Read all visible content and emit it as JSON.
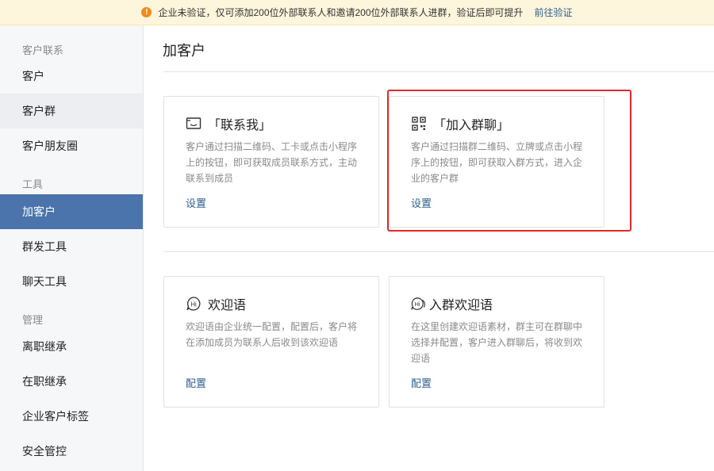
{
  "banner": {
    "text": "企业未验证，仅可添加200位外部联系人和邀请200位外部联系人进群，验证后即可提升",
    "link": "前往验证"
  },
  "sidebar": {
    "groups": [
      {
        "title": "客户联系",
        "items": [
          "客户",
          "客户群",
          "客户朋友圈"
        ]
      },
      {
        "title": "工具",
        "items": [
          "加客户",
          "群发工具",
          "聊天工具"
        ]
      },
      {
        "title": "管理",
        "items": [
          "离职继承",
          "在职继承",
          "企业客户标签",
          "安全管控"
        ]
      }
    ],
    "active_item": "加客户",
    "hover_item": "客户群"
  },
  "main": {
    "title": "加客户",
    "cards": [
      {
        "icon": "contact-card-icon",
        "title": "「联系我」",
        "desc": "客户通过扫描二维码、工卡或点击小程序上的按钮，即可获取成员联系方式，主动联系到成员",
        "action": "设置"
      },
      {
        "icon": "qr-code-icon",
        "title": "「加入群聊」",
        "desc": "客户通过扫描群二维码、立牌或点击小程序上的按钮，即可获取入群方式，进入企业的客户群",
        "action": "设置"
      },
      {
        "icon": "hi-bubble-icon",
        "title": "欢迎语",
        "desc": "欢迎语由企业统一配置，配置后，客户将在添加成员为联系人后收到该欢迎语",
        "action": "配置"
      },
      {
        "icon": "hi-group-bubble-icon",
        "title": "入群欢迎语",
        "desc": "在这里创建欢迎语素材，群主可在群聊中选择并配置，客户进入群聊后，将收到欢迎语",
        "action": "配置"
      }
    ]
  },
  "colors": {
    "accent": "#4a74ab",
    "link": "#2f5f8f",
    "highlight": "#e22a2a",
    "banner_bg": "#fdf6dc"
  }
}
